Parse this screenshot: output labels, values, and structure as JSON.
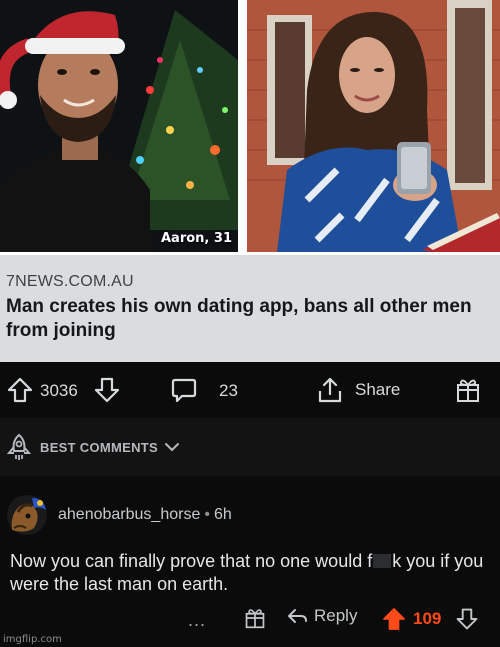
{
  "photos": {
    "left_caption": "Aaron, 31"
  },
  "article": {
    "source": "7NEWS.COM.AU",
    "headline": "Man creates his own dating app, bans all other men from joining"
  },
  "post_actions": {
    "vote_count": "3036",
    "comment_count": "23",
    "share_label": "Share"
  },
  "sort": {
    "label": "BEST COMMENTS"
  },
  "comment": {
    "author": "ahenobarbus_horse",
    "separator": "•",
    "age": "6h",
    "body_before": "Now you can finally prove that no one would f",
    "body_after": "k you if you were the last man on earth.",
    "more_label": "...",
    "reply_label": "Reply",
    "score": "109"
  },
  "watermark": "imgflip.com",
  "colors": {
    "background": "#0b0b0b",
    "article_bg": "#dadcdf",
    "upvote_active": "#ff4a1a",
    "text_light": "#d7dadc"
  }
}
